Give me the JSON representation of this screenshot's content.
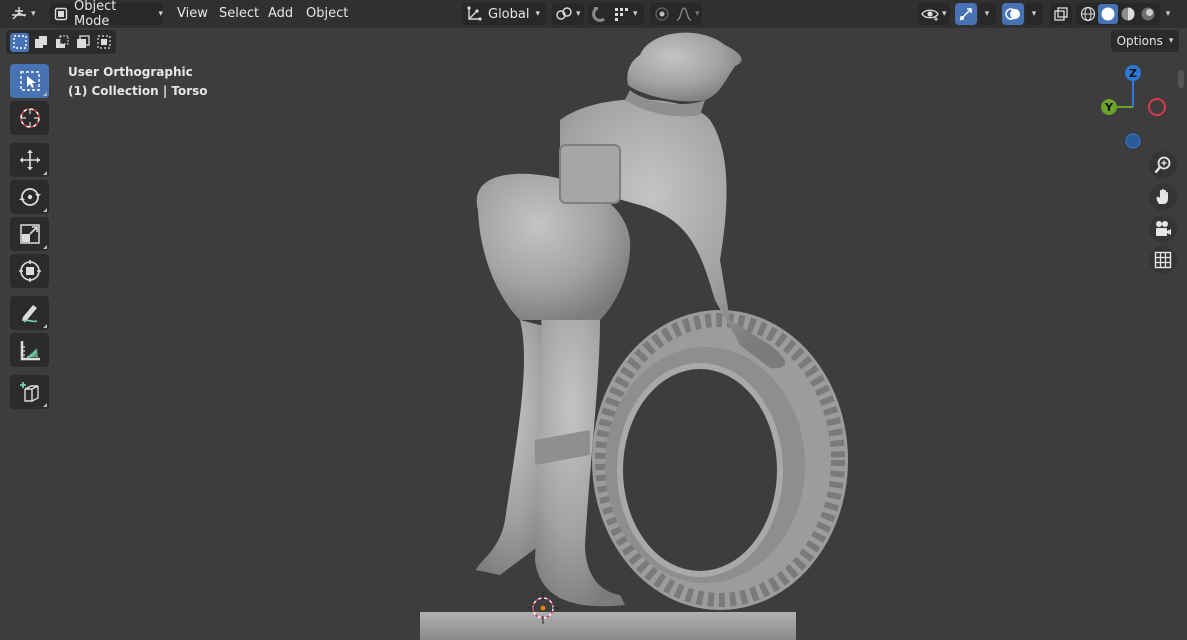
{
  "header": {
    "editor_type_icon": "3d-viewport-icon",
    "mode": {
      "label": "Object Mode",
      "icon": "object-mode-icon"
    },
    "menus": [
      "View",
      "Select",
      "Add",
      "Object"
    ],
    "transform_orientation": {
      "label": "Global",
      "icon": "orientation-global-icon"
    },
    "pivot_icon": "pivot-point-icon",
    "snap_icon": "snap-icon",
    "snap_target_icon": "snap-increment-icon",
    "proportional_icon": "proportional-editing-icon",
    "falloff_icon": "falloff-curve-icon",
    "visibility_icon": "eye-visibility-icon",
    "gizmo_icon": "gizmo-icon",
    "overlay_icon": "overlays-icon",
    "xray_icon": "xray-icon",
    "shading_modes": [
      "wireframe-shading-icon",
      "solid-shading-icon",
      "material-preview-icon",
      "rendered-shading-icon"
    ],
    "active_shading": "solid-shading-icon"
  },
  "select_modes": [
    "select-new-icon",
    "select-extend-icon",
    "select-subtract-icon",
    "select-invert-icon",
    "select-intersect-icon"
  ],
  "options_label": "Options",
  "viewport": {
    "view_name": "User Orthographic",
    "collection_info": "(1) Collection | Torso"
  },
  "tools": [
    {
      "name": "select-box-tool",
      "icon": "select-box-icon",
      "active": true
    },
    {
      "name": "cursor-tool",
      "icon": "cursor-icon",
      "active": false
    },
    {
      "name": "move-tool",
      "icon": "move-icon",
      "active": false
    },
    {
      "name": "rotate-tool",
      "icon": "rotate-icon",
      "active": false
    },
    {
      "name": "scale-tool",
      "icon": "scale-icon",
      "active": false
    },
    {
      "name": "transform-tool",
      "icon": "transform-icon",
      "active": false
    },
    {
      "name": "annotate-tool",
      "icon": "annotate-icon",
      "active": false
    },
    {
      "name": "measure-tool",
      "icon": "measure-icon",
      "active": false
    },
    {
      "name": "add-cube-tool",
      "icon": "add-cube-icon",
      "active": false
    }
  ],
  "gizmo": {
    "axes": [
      {
        "label": "Z",
        "color": "#2c7ad6"
      },
      {
        "label": "Y",
        "color": "#6ca32a"
      }
    ],
    "neg_x_color": "#d63a4f",
    "neg_z_color": "#2c7ad6"
  },
  "nav_buttons": [
    "zoom-icon",
    "hand-pan-icon",
    "camera-view-icon",
    "orthographic-grid-icon"
  ],
  "colors": {
    "header_bg": "#303030",
    "viewport_bg": "#3d3d3d",
    "active_blue": "#4772b3",
    "model_gray": "#a8a8a8"
  }
}
